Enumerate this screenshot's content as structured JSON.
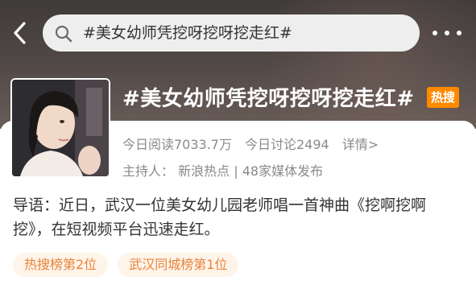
{
  "header": {
    "search_text": "#美女幼师凭挖呀挖呀挖走红#"
  },
  "topic": {
    "title": "#美女幼师凭挖呀挖呀挖走红#",
    "badge": "热搜",
    "reads": "今日阅读7033.7万",
    "discussions": "今日讨论2494",
    "details_link": "详情>",
    "host_label": "主持人：",
    "host_name": "新浪热点",
    "separator": "|",
    "media": "48家媒体发布",
    "intro": "导语：近日，武汉一位美女幼儿园老师唱一首神曲《挖啊挖啊挖》，在短视频平台迅速走红。",
    "tags": [
      "热搜榜第2位",
      "武汉同城榜第1位"
    ]
  },
  "colors": {
    "accent_orange": "#ff8a00",
    "tag_text": "#e8833a",
    "tag_bg": "#fff4ea"
  }
}
